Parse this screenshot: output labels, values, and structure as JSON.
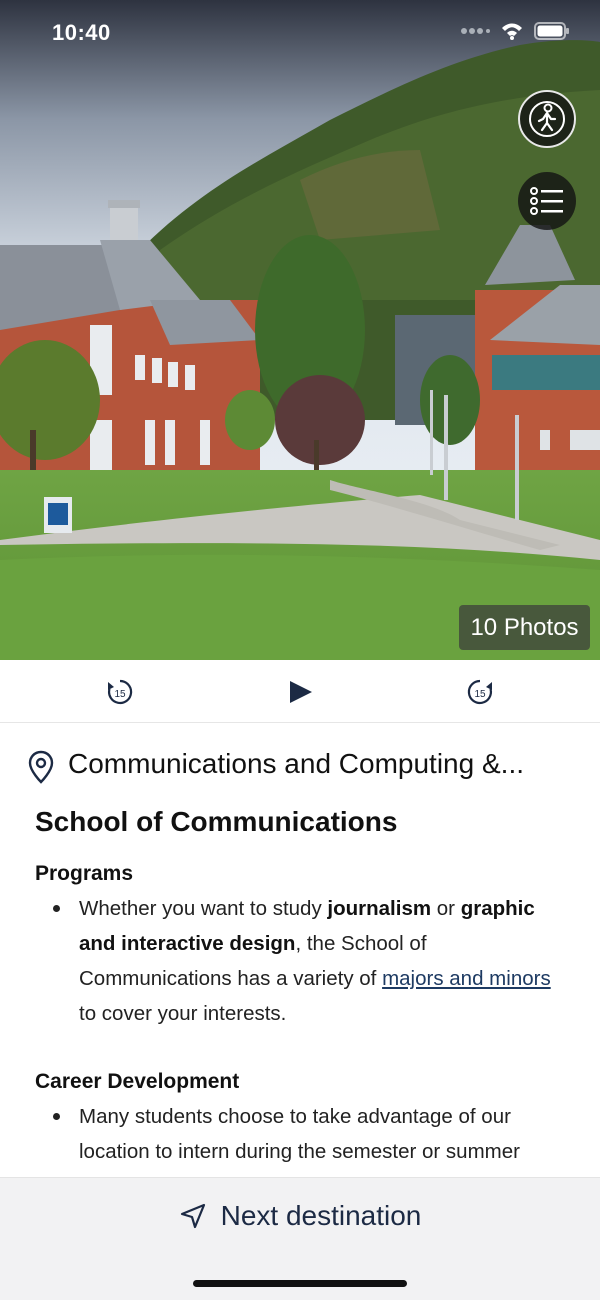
{
  "status_bar": {
    "time": "10:40"
  },
  "hero": {
    "photos_label": "10 Photos"
  },
  "player": {
    "rewind_seconds": "15",
    "forward_seconds": "15"
  },
  "location": {
    "title": "Communications and Computing &..."
  },
  "article": {
    "heading": "School of Communications",
    "sections": [
      {
        "title": "Programs",
        "bullet": {
          "t1": "Whether you want to study ",
          "b1": "journalism",
          "t2": " or ",
          "b2": "graphic and interactive design",
          "t3": ", the School of Communications has a variety of ",
          "link": "majors and minors",
          "t4": " to cover your interests."
        }
      },
      {
        "title": "Career Development",
        "bullet": {
          "t1": "Many students choose to take advantage of our location to intern during the semester or summer"
        }
      }
    ]
  },
  "next": {
    "label": "Next destination"
  },
  "colors": {
    "accent": "#1c2a44",
    "link": "#1d3a62",
    "brick": "#b5553b"
  }
}
